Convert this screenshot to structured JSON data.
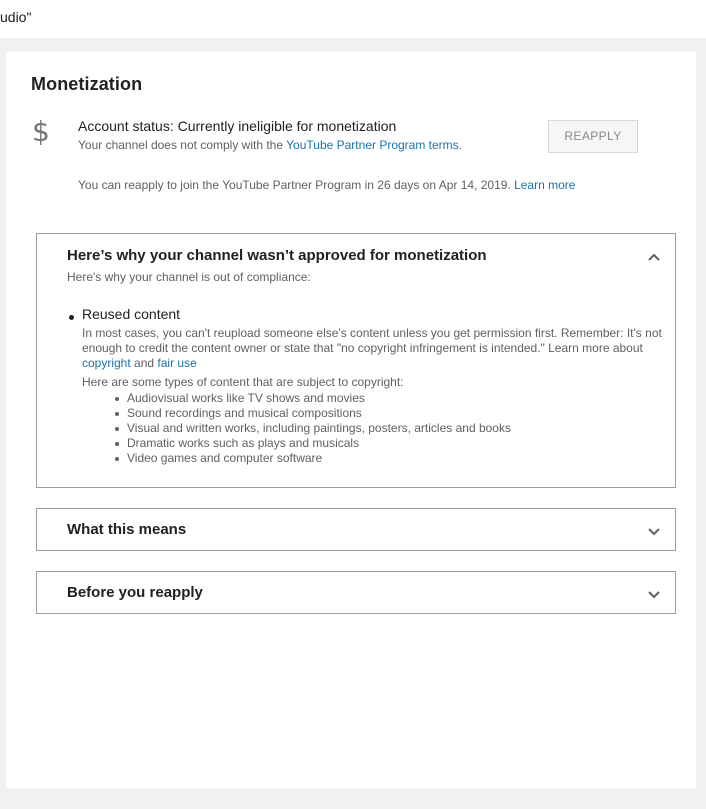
{
  "topbar": {
    "text": "udio\""
  },
  "monetization": {
    "title": "Monetization",
    "account_status": "Account status: Currently ineligible for monetization",
    "status_sub_prefix": "Your channel does not comply with the ",
    "status_sub_link": "YouTube Partner Program terms",
    "status_sub_suffix": ".",
    "reapply_button": "REAPPLY",
    "reapply_note": "You can reapply to join the YouTube Partner Program in 26 days on Apr 14, 2019. ",
    "learn_more": "Learn more"
  },
  "panels": {
    "why": {
      "title": "Here’s why your channel wasn’t approved for monetization",
      "subtitle": "Here's why your channel is out of compliance:",
      "reason_title": "Reused content",
      "para_text": "In most cases, you can't reupload someone else's content unless you get permission first. Remember: It's not enough to credit the content owner or state that \"no copyright infringement is intended.\" Learn more about ",
      "copyright_link": "copyright",
      "and_text": " and ",
      "fair_use_link": "fair use",
      "types_intro": "Here are some types of content that are subject to copyright:",
      "types": [
        "Audiovisual works like TV shows and movies",
        "Sound recordings and musical compositions",
        "Visual and written works, including paintings, posters, articles and books",
        "Dramatic works such as plays and musicals",
        "Video games and computer software"
      ]
    },
    "means": {
      "title": "What this means"
    },
    "before": {
      "title": "Before you reapply"
    }
  },
  "icons": {
    "dollar": "dollar-icon",
    "chevron_up": "chevron-up-icon",
    "chevron_down": "chevron-down-icon"
  },
  "colors": {
    "link": "#1a73a8",
    "panel_border": "#9e9e9e",
    "background": "#f1f1f1"
  }
}
